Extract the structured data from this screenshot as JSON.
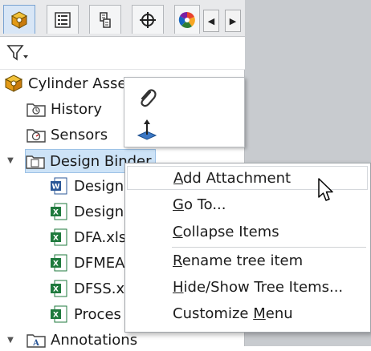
{
  "tabs": [
    {
      "name": "featuremanager-tab",
      "icon": "featuremanager-cube-icon"
    },
    {
      "name": "propertymanager-tab",
      "icon": "propertymanager-list-icon"
    },
    {
      "name": "configurationmanager-tab",
      "icon": "configurationmanager-icon"
    },
    {
      "name": "dimxpert-tab",
      "icon": "crosshair-icon"
    },
    {
      "name": "display-manager-tab",
      "icon": "color-wheel-icon"
    }
  ],
  "tree": {
    "root": "Cylinder Asse",
    "items": [
      {
        "label": "History",
        "icon": "history-folder-icon"
      },
      {
        "label": "Sensors",
        "icon": "sensors-folder-icon"
      },
      {
        "label": "Design Binder",
        "icon": "design-binder-folder-icon"
      },
      {
        "label": "Design",
        "icon": "word-document-icon"
      },
      {
        "label": "Design",
        "icon": "excel-document-icon"
      },
      {
        "label": "DFA.xls",
        "icon": "excel-document-icon"
      },
      {
        "label": "DFMEA",
        "icon": "excel-document-icon"
      },
      {
        "label": "DFSS.x",
        "icon": "excel-document-icon"
      },
      {
        "label": "Proces",
        "icon": "excel-document-icon"
      },
      {
        "label": "Annotations",
        "icon": "annotations-folder-icon"
      }
    ]
  },
  "context_menu": {
    "items": [
      {
        "pre": "",
        "u": "A",
        "post": "dd Attachment"
      },
      {
        "pre": "",
        "u": "G",
        "post": "o To..."
      },
      {
        "pre": "",
        "u": "C",
        "post": "ollapse Items"
      },
      {
        "pre": "",
        "u": "R",
        "post": "ename tree item"
      },
      {
        "pre": "",
        "u": "H",
        "post": "ide/Show Tree Items..."
      },
      {
        "pre": "Customize ",
        "u": "M",
        "post": "enu"
      }
    ]
  },
  "mini_toolbar": {
    "icons": [
      "paperclip-icon",
      "normal-to-icon"
    ]
  },
  "colors": {
    "accent": "#3b77c4",
    "excel_green": "#1f7a3d",
    "word_blue": "#2b5797",
    "folder_outline": "#444444"
  }
}
